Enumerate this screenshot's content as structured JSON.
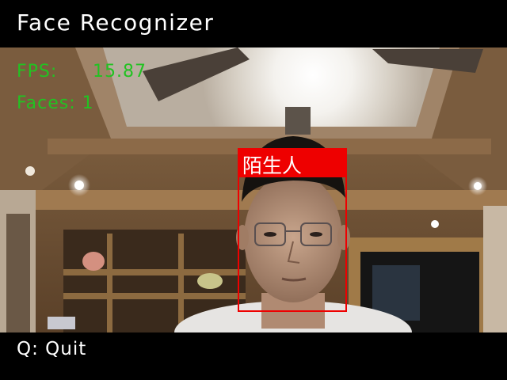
{
  "app": {
    "title": "Face Recognizer"
  },
  "stats": {
    "fps_label": "FPS:",
    "fps_value": "15.87",
    "faces_label": "Faces:",
    "faces_value": "1"
  },
  "detection": {
    "label": "陌生人",
    "box_color": "#ee0000"
  },
  "footer": {
    "quit_hint": "Q: Quit"
  },
  "colors": {
    "stats_text": "#22c222",
    "bar_background": "#000000",
    "title_text": "#ffffff"
  }
}
